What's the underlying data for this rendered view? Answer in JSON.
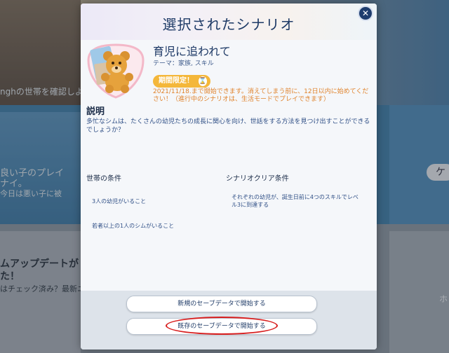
{
  "background": {
    "household_text": "nghの世帯を確認しよう",
    "card_title": "良い子のプレイ\nナイ。",
    "card_sub": "今日は悪い子に被",
    "update_title": "ムアップデートが\nた！",
    "update_sub": "はチェック済み？最新ニュー",
    "side_button_1": "ケ",
    "side_text": "ホ"
  },
  "modal": {
    "title": "選択されたシナリオ",
    "close_glyph": "✕",
    "scenario_name": "育児に追われて",
    "theme": "テーマ：家族, スキル",
    "limited_label": "期間限定！",
    "hourglass_glyph": "⌛",
    "deadline": "2021/11/18.まで開始できます。消えてしまう前に、12日以内に始めてください！（進行中のシナリオは、生活モードでプレイできます）",
    "description_heading": "説明",
    "description": "多忙なシムは、たくさんの幼児たちの成長に関心を向け、世話をする方法を見つけ出すことができるでしょうか？",
    "household_conditions_heading": "世帯の条件",
    "household_conditions": [
      "3人の幼児がいること",
      "若者以上の1人のシムがいること"
    ],
    "clear_conditions_heading": "シナリオクリア条件",
    "clear_conditions": [
      "それぞれの幼児が、誕生日前に4つのスキルでレベル3に到達する"
    ],
    "new_save_button": "新規のセーブデータで開始する",
    "existing_save_button": "既存のセーブデータで開始する"
  },
  "colors": {
    "title": "#1e3a66",
    "accent_orange": "#f4b73a",
    "deadline_orange": "#e0832c",
    "highlight_red": "#d81e1e"
  }
}
